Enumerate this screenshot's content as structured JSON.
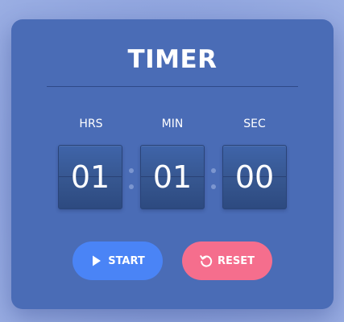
{
  "timer": {
    "title": "TIMER",
    "units": {
      "hours_label": "HRS",
      "minutes_label": "MIN",
      "seconds_label": "SEC"
    },
    "values": {
      "hours": "01",
      "minutes": "01",
      "seconds": "00"
    },
    "buttons": {
      "start_label": "START",
      "start_icon": "play-icon",
      "reset_label": "RESET",
      "reset_icon": "reset-icon"
    },
    "colors": {
      "card": "#4a6cb6",
      "start": "#4a84f6",
      "reset": "#f56e8d",
      "background": "#8ea3dd"
    }
  }
}
